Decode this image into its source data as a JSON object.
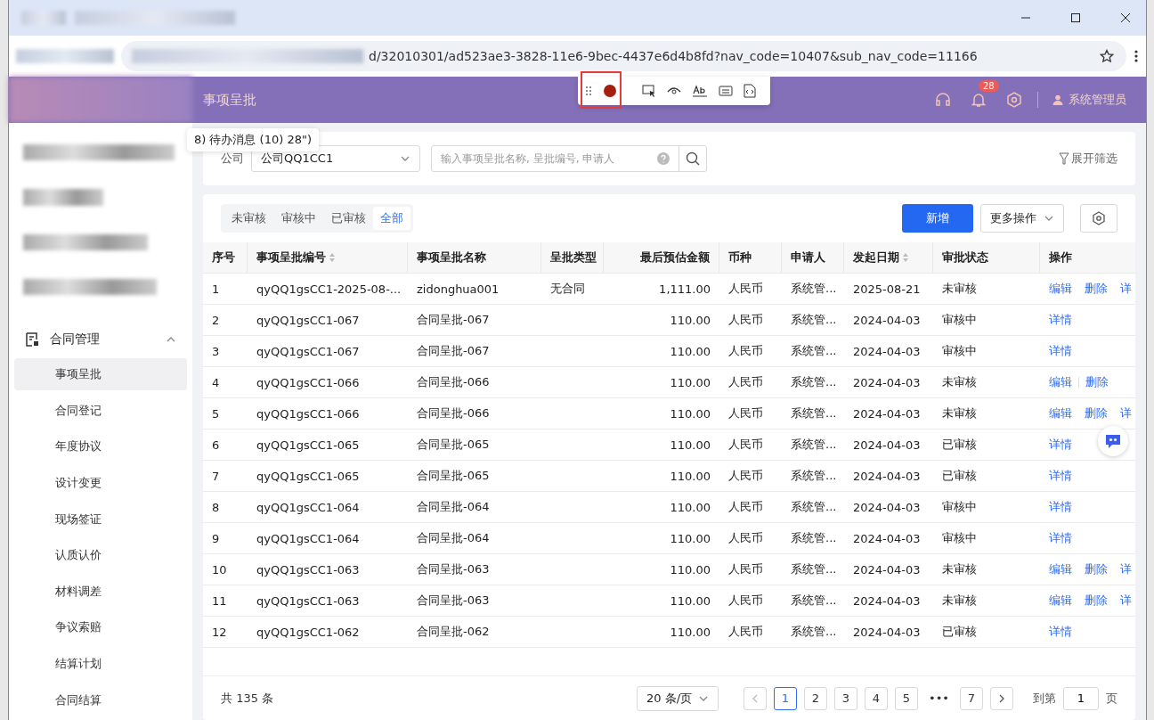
{
  "browser": {
    "url": "d/32010301/ad523ae3-3828-11e6-9bec-4437e6d4b8fd?nav_code=10407&sub_nav_code=11166"
  },
  "header": {
    "title": "事项呈批",
    "badge": "28",
    "user": "系统管理员"
  },
  "recorder": {
    "recording": true
  },
  "tooltip": "8) 待办消息 (10) 28\")",
  "sidebar": {
    "group": {
      "label": "合同管理",
      "expanded": true,
      "children": [
        {
          "label": "事项呈批",
          "selected": true
        },
        {
          "label": "合同登记",
          "selected": false
        },
        {
          "label": "年度协议",
          "selected": false
        },
        {
          "label": "设计变更",
          "selected": false
        },
        {
          "label": "现场签证",
          "selected": false
        },
        {
          "label": "认质认价",
          "selected": false
        },
        {
          "label": "材料调差",
          "selected": false
        },
        {
          "label": "争议索赔",
          "selected": false
        },
        {
          "label": "结算计划",
          "selected": false
        },
        {
          "label": "合同结算",
          "selected": false
        }
      ]
    }
  },
  "filter": {
    "company_label": "公司",
    "company_value": "公司QQ1CC1",
    "search_placeholder": "输入事项呈批名称, 呈批编号, 申请人",
    "expand": "展开筛选"
  },
  "status_tabs": [
    {
      "label": "未审核",
      "selected": false
    },
    {
      "label": "审核中",
      "selected": false
    },
    {
      "label": "已审核",
      "selected": false
    },
    {
      "label": "全部",
      "selected": true
    }
  ],
  "actions": {
    "primary": "新增",
    "more": "更多操作"
  },
  "table": {
    "columns": [
      {
        "label": "序号"
      },
      {
        "label": "事项呈批编号",
        "sortable": true
      },
      {
        "label": "事项呈批名称"
      },
      {
        "label": "呈批类型"
      },
      {
        "label": "最后预估金额"
      },
      {
        "label": "币种"
      },
      {
        "label": "申请人"
      },
      {
        "label": "发起日期",
        "sortable": true
      },
      {
        "label": "审批状态"
      },
      {
        "label": "操作"
      }
    ],
    "rows": [
      {
        "cells": [
          "1",
          "qyQQ1gsCC1-2025-08-...",
          "zidonghua001",
          "无合同",
          "1,111.00",
          "人民币",
          "系统管...",
          "2025-08-21",
          "未审核"
        ],
        "ops": [
          "编辑",
          "删除",
          "详"
        ]
      },
      {
        "cells": [
          "2",
          "qyQQ1gsCC1-067",
          "合同呈批-067",
          "",
          "110.00",
          "人民币",
          "系统管...",
          "2024-04-03",
          "审核中"
        ],
        "ops": [
          "详情"
        ]
      },
      {
        "cells": [
          "3",
          "qyQQ1gsCC1-067",
          "合同呈批-067",
          "",
          "110.00",
          "人民币",
          "系统管...",
          "2024-04-03",
          "审核中"
        ],
        "ops": [
          "详情"
        ]
      },
      {
        "cells": [
          "4",
          "qyQQ1gsCC1-066",
          "合同呈批-066",
          "",
          "110.00",
          "人民币",
          "系统管...",
          "2024-04-03",
          "未审核"
        ],
        "ops": [
          "编辑",
          "删除"
        ]
      },
      {
        "cells": [
          "5",
          "qyQQ1gsCC1-066",
          "合同呈批-066",
          "",
          "110.00",
          "人民币",
          "系统管...",
          "2024-04-03",
          "未审核"
        ],
        "ops": [
          "编辑",
          "删除",
          "详"
        ]
      },
      {
        "cells": [
          "6",
          "qyQQ1gsCC1-065",
          "合同呈批-065",
          "",
          "110.00",
          "人民币",
          "系统管...",
          "2024-04-03",
          "已审核"
        ],
        "ops": [
          "详情"
        ]
      },
      {
        "cells": [
          "7",
          "qyQQ1gsCC1-065",
          "合同呈批-065",
          "",
          "110.00",
          "人民币",
          "系统管...",
          "2024-04-03",
          "已审核"
        ],
        "ops": [
          "详情"
        ]
      },
      {
        "cells": [
          "8",
          "qyQQ1gsCC1-064",
          "合同呈批-064",
          "",
          "110.00",
          "人民币",
          "系统管...",
          "2024-04-03",
          "审核中"
        ],
        "ops": [
          "详情"
        ]
      },
      {
        "cells": [
          "9",
          "qyQQ1gsCC1-064",
          "合同呈批-064",
          "",
          "110.00",
          "人民币",
          "系统管...",
          "2024-04-03",
          "审核中"
        ],
        "ops": [
          "详情"
        ]
      },
      {
        "cells": [
          "10",
          "qyQQ1gsCC1-063",
          "合同呈批-063",
          "",
          "110.00",
          "人民币",
          "系统管...",
          "2024-04-03",
          "未审核"
        ],
        "ops": [
          "编辑",
          "删除",
          "详"
        ]
      },
      {
        "cells": [
          "11",
          "qyQQ1gsCC1-063",
          "合同呈批-063",
          "",
          "110.00",
          "人民币",
          "系统管...",
          "2024-04-03",
          "未审核"
        ],
        "ops": [
          "编辑",
          "删除",
          "详"
        ]
      },
      {
        "cells": [
          "12",
          "qyQQ1gsCC1-062",
          "合同呈批-062",
          "",
          "110.00",
          "人民币",
          "系统管...",
          "2024-04-03",
          "已审核"
        ],
        "ops": [
          "详情"
        ]
      }
    ]
  },
  "pagination": {
    "total": "共 135 条",
    "page_size": "20 条/页",
    "pages": [
      {
        "label": "1",
        "selected": true
      },
      {
        "label": "2",
        "selected": false
      },
      {
        "label": "3",
        "selected": false
      },
      {
        "label": "4",
        "selected": false
      },
      {
        "label": "5",
        "selected": false
      },
      {
        "label": "•••",
        "selected": false
      },
      {
        "label": "7",
        "selected": false
      }
    ],
    "goto": "到第",
    "goto_value": "1",
    "goto_suffix": "页"
  }
}
